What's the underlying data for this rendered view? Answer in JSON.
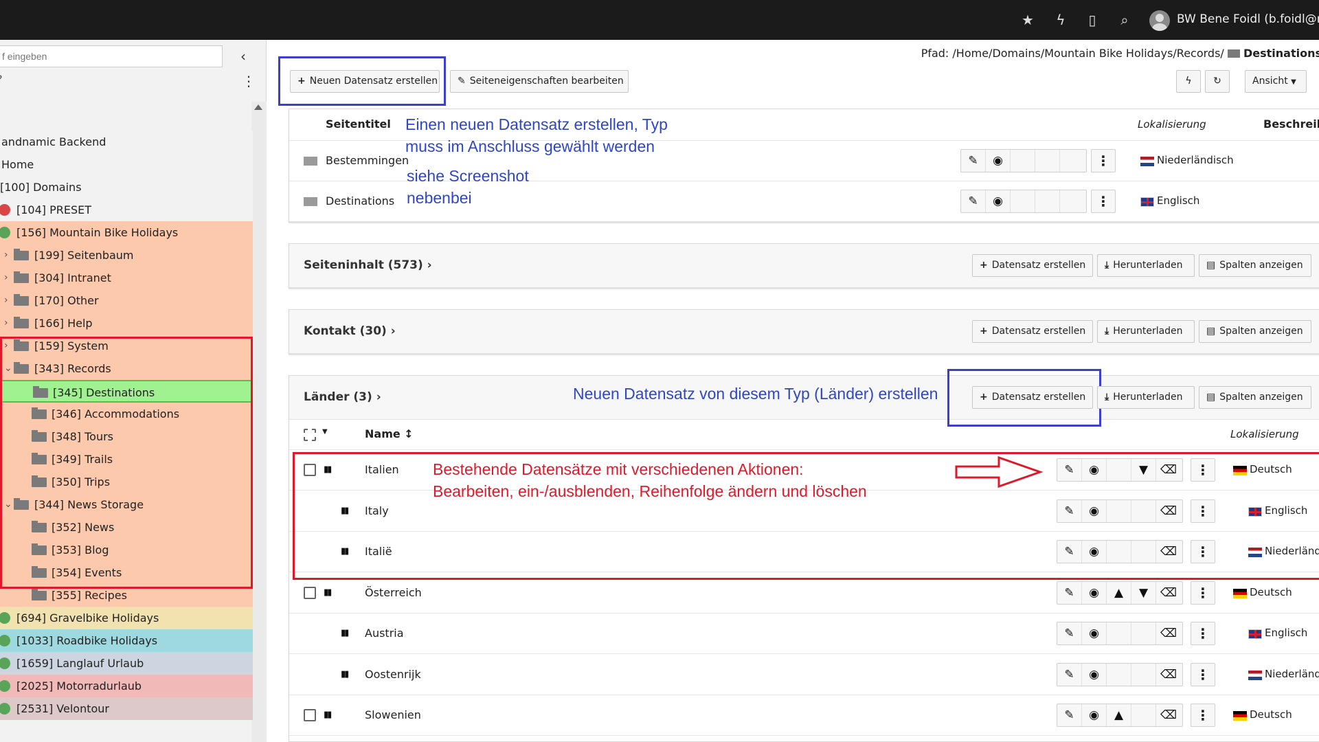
{
  "topbar": {
    "user": "BW Bene Foidl (b.foidl@mt",
    "icons": [
      "star-icon",
      "bolt-icon",
      "file-icon",
      "search-icon",
      "user-avatar"
    ]
  },
  "sidebar": {
    "search_placeholder": "f eingeben",
    "items": [
      {
        "label": "andnamic Backend",
        "bg": "#f2f2f2"
      },
      {
        "label": "Home",
        "bg": "#f2f2f2"
      },
      {
        "label": "[100] Domains",
        "bg": "#f2f2f2"
      },
      {
        "label": "[104] PRESET",
        "bg": "#f2f2f2"
      },
      {
        "label": "[156] Mountain Bike Holidays",
        "bg": "#fcc9ad"
      },
      {
        "label": "[199] Seitenbaum",
        "bg": "#fcc9ad"
      },
      {
        "label": "[304] Intranet",
        "bg": "#fcc9ad"
      },
      {
        "label": "[170] Other",
        "bg": "#fcc9ad"
      },
      {
        "label": "[166] Help",
        "bg": "#fcc9ad"
      },
      {
        "label": "[159] System",
        "bg": "#fcc9ad"
      },
      {
        "label": "[343] Records",
        "bg": "#fcc9ad"
      },
      {
        "label": "[345] Destinations",
        "bg": "#9ff28f"
      },
      {
        "label": "[346] Accommodations",
        "bg": "#fcc9ad"
      },
      {
        "label": "[348] Tours",
        "bg": "#fcc9ad"
      },
      {
        "label": "[349] Trails",
        "bg": "#fcc9ad"
      },
      {
        "label": "[350] Trips",
        "bg": "#fcc9ad"
      },
      {
        "label": "[344] News Storage",
        "bg": "#fcc9ad"
      },
      {
        "label": "[352] News",
        "bg": "#fcc9ad"
      },
      {
        "label": "[353] Blog",
        "bg": "#fcc9ad"
      },
      {
        "label": "[354] Events",
        "bg": "#fcc9ad"
      },
      {
        "label": "[355] Recipes",
        "bg": "#fcc9ad"
      },
      {
        "label": "[694] Gravelbike Holidays",
        "bg": "#f2e2b0"
      },
      {
        "label": "[1033] Roadbike Holidays",
        "bg": "#9fd9e0"
      },
      {
        "label": "[1659] Langlauf Urlaub",
        "bg": "#cdd6e0"
      },
      {
        "label": "[2025] Motorradurlaub",
        "bg": "#f2b9b9"
      },
      {
        "label": "[2531] Velontour",
        "bg": "#ddc9c9"
      }
    ]
  },
  "toolbar": {
    "path_prefix": "Pfad: /Home/Domains/Mountain Bike Holidays/Records/",
    "path_current": "Destinations",
    "new_record": "Neuen Datensatz erstellen",
    "edit_page_props": "Seiteneigenschaften bearbeiten",
    "view": "Ansicht"
  },
  "pages_panel": {
    "col_title": "Seitentitel",
    "col_loc": "Lokalisierung",
    "col_desc": "Beschreib",
    "rows": [
      {
        "title": "Bestemmingen",
        "lang": "Niederländisch"
      },
      {
        "title": "Destinations",
        "lang": "Englisch"
      }
    ]
  },
  "sections": [
    {
      "title": "Seiteninhalt (573)",
      "create": "Datensatz erstellen",
      "download": "Herunterladen",
      "columns": "Spalten anzeigen"
    },
    {
      "title": "Kontakt (30)",
      "create": "Datensatz erstellen",
      "download": "Herunterladen",
      "columns": "Spalten anzeigen"
    },
    {
      "title": "Länder (3)",
      "create": "Datensatz erstellen",
      "download": "Herunterladen",
      "columns": "Spalten anzeigen"
    }
  ],
  "laender": {
    "col_name": "Name",
    "col_loc": "Lokalisierung",
    "rows": [
      {
        "name": "Italien",
        "lang": "Deutsch"
      },
      {
        "name": "Italy",
        "lang": "Englisch"
      },
      {
        "name": "Italië",
        "lang": "Niederländ"
      },
      {
        "name": "Österreich",
        "lang": "Deutsch"
      },
      {
        "name": "Austria",
        "lang": "Englisch"
      },
      {
        "name": "Oostenrijk",
        "lang": "Niederländ"
      },
      {
        "name": "Slowenien",
        "lang": "Deutsch"
      }
    ]
  },
  "annotations": {
    "new_record_1": "Einen neuen Datensatz erstellen, Typ",
    "new_record_2": "muss im Anschluss gewählt werden",
    "screenshot_1": "siehe Screenshot",
    "screenshot_2": "nebenbei",
    "laender_create": "Neuen Datensatz von diesem Typ (Länder) erstellen",
    "existing_1": "Bestehende Datensätze mit verschiedenen Aktionen:",
    "existing_2": "Bearbeiten, ein-/ausblenden, Reihenfolge ändern und löschen"
  }
}
